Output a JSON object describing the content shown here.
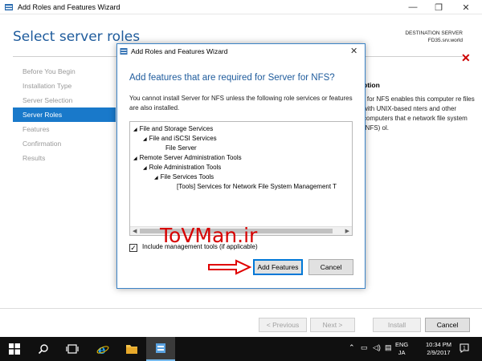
{
  "window": {
    "title": "Add Roles and Features Wizard",
    "minimize_glyph": "—",
    "maximize_glyph": "❐",
    "close_glyph": "✕"
  },
  "page": {
    "heading": "Select server roles",
    "destination_label": "DESTINATION SERVER",
    "destination_server": "FD35.srv.world"
  },
  "nav": {
    "items": [
      {
        "label": "Before You Begin",
        "active": false
      },
      {
        "label": "Installation Type",
        "active": false
      },
      {
        "label": "Server Selection",
        "active": false
      },
      {
        "label": "Server Roles",
        "active": true
      },
      {
        "label": "Features",
        "active": false
      },
      {
        "label": "Confirmation",
        "active": false
      },
      {
        "label": "Results",
        "active": false
      }
    ]
  },
  "description": {
    "heading": "ption",
    "body": "r for NFS enables this computer re files with UNIX-based nters and other computers that e network file system (NFS) ol."
  },
  "footer": {
    "previous": "< Previous",
    "next": "Next >",
    "install": "Install",
    "cancel": "Cancel"
  },
  "dialog": {
    "title": "Add Roles and Features Wizard",
    "heading": "Add features that are required for Server for NFS?",
    "description": "You cannot install Server for NFS unless the following role services or features are also installed.",
    "tree": [
      {
        "label": "File and Storage Services",
        "level": 0,
        "expand": "◢"
      },
      {
        "label": "File and iSCSI Services",
        "level": 1,
        "expand": "◢"
      },
      {
        "label": "File Server",
        "level": 2,
        "expand": ""
      },
      {
        "label": "Remote Server Administration Tools",
        "level": 0,
        "expand": "◢"
      },
      {
        "label": "Role Administration Tools",
        "level": 1,
        "expand": "◢"
      },
      {
        "label": "File Services Tools",
        "level": 2,
        "expand": "◢"
      },
      {
        "label": "[Tools] Services for Network File System Management T",
        "level": 4,
        "expand": ""
      }
    ],
    "include_tools_label": "Include management tools (if applicable)",
    "include_tools_checked": true,
    "add_features": "Add Features",
    "cancel": "Cancel",
    "watermark": "ToVMan.ir"
  },
  "taskbar": {
    "lang_top": "ENG",
    "lang_bottom": "JA",
    "time": "10:34 PM",
    "date": "2/9/2017",
    "notify_count": "1"
  },
  "colors": {
    "accent": "#1979ca",
    "heading_blue": "#1e5b9c",
    "watermark_red": "#d70000",
    "taskbar": "#101010"
  }
}
